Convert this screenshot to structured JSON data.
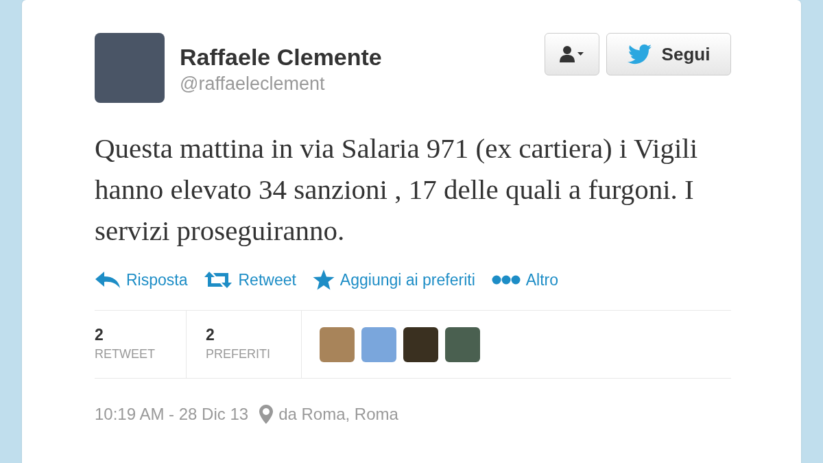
{
  "author": {
    "name": "Raffaele Clemente",
    "handle": "@raffaeleclement"
  },
  "follow_button": {
    "label": "Segui"
  },
  "tweet_text": "Questa mattina in via Salaria 971 (ex cartiera) i Vigili hanno elevato 34 sanzioni , 17 delle quali a furgoni. I servizi proseguiranno.",
  "actions": [
    {
      "kind": "reply",
      "label": "Risposta"
    },
    {
      "kind": "retweet",
      "label": "Retweet"
    },
    {
      "kind": "favorite",
      "label": "Aggiungi ai preferiti"
    },
    {
      "kind": "more",
      "label": "Altro"
    }
  ],
  "stats": [
    {
      "count": "2",
      "label": "RETWEET"
    },
    {
      "count": "2",
      "label": "PREFERITI"
    }
  ],
  "avatars": [
    {
      "color": "#a8845a"
    },
    {
      "color": "#7aa6dc"
    },
    {
      "color": "#3a3020"
    },
    {
      "color": "#4a6050"
    }
  ],
  "footer": {
    "time": "10:19 AM - 28 Dic 13",
    "location": "da Roma, Roma"
  }
}
